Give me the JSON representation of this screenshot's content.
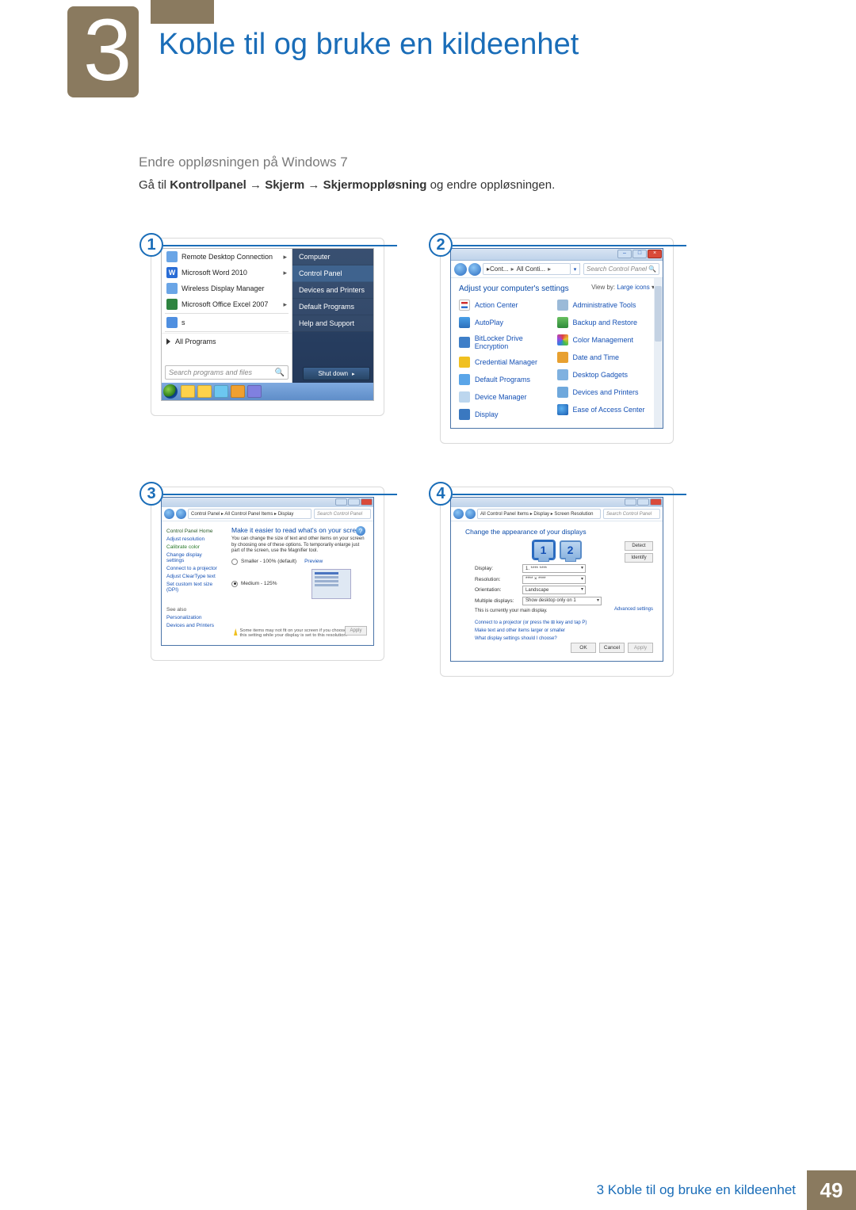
{
  "chapter": {
    "number": "3",
    "title": "Koble til og bruke en kildeenhet"
  },
  "section_subtitle": "Endre oppløsningen på Windows 7",
  "instruction": {
    "prefix": "Gå til ",
    "b1": "Kontrollpanel",
    "arrow": " → ",
    "b2": "Skjerm",
    "b3": "Skjermoppløsning",
    "suffix": " og endre oppløsningen."
  },
  "step_labels": {
    "s1": "1",
    "s2": "2",
    "s3": "3",
    "s4": "4"
  },
  "step1": {
    "left_items": [
      "Remote Desktop Connection",
      "Microsoft Word 2010",
      "Wireless Display Manager",
      "Microsoft Office Excel 2007"
    ],
    "blank_label": "s",
    "all_programs": "All Programs",
    "search_placeholder": "Search programs and files",
    "right_links": [
      "Computer",
      "Control Panel",
      "Devices and Printers",
      "Default Programs",
      "Help and Support"
    ],
    "shutdown": "Shut down"
  },
  "step2": {
    "crumb_parts": [
      "Cont...",
      "All Conti..."
    ],
    "search_placeholder": "Search Control Panel",
    "heading": "Adjust your computer's settings",
    "viewby_label": "View by:",
    "viewby_value": "Large icons",
    "left_col": [
      "Action Center",
      "AutoPlay",
      "BitLocker Drive Encryption",
      "Credential Manager",
      "Default Programs",
      "Device Manager",
      "Display"
    ],
    "right_col": [
      "Administrative Tools",
      "Backup and Restore",
      "Color Management",
      "Date and Time",
      "Desktop Gadgets",
      "Devices and Printers",
      "Ease of Access Center"
    ]
  },
  "step3": {
    "crumb": "Control Panel  ▸  All Control Panel Items  ▸  Display",
    "search_placeholder": "Search Control Panel",
    "side": {
      "home": "Control Panel Home",
      "links": [
        "Adjust resolution",
        "Calibrate color",
        "Change display settings",
        "Connect to a projector",
        "Adjust ClearType text",
        "Set custom text size (DPI)"
      ],
      "see_also": "See also",
      "see_links": [
        "Personalization",
        "Devices and Printers"
      ]
    },
    "heading": "Make it easier to read what's on your screen",
    "paragraph": "You can change the size of text and other items on your screen by choosing one of these options. To temporarily enlarge just part of the screen, use the Magnifier tool.",
    "opt1": "Smaller - 100% (default)",
    "opt1_note": "Preview",
    "opt2": "Medium - 125%",
    "warn": "Some items may not fit on your screen if you choose this setting while your display is set to this resolution.",
    "apply": "Apply"
  },
  "step4": {
    "crumb": "All Control Panel Items  ▸  Display  ▸  Screen Resolution",
    "search_placeholder": "Search Control Panel",
    "heading": "Change the appearance of your displays",
    "mon1": "1",
    "mon2": "2",
    "detect": "Detect",
    "identify": "Identify",
    "rows": {
      "display_lbl": "Display:",
      "display_val": "1. **** ****",
      "res_lbl": "Resolution:",
      "res_val": "**** × ****",
      "orient_lbl": "Orientation:",
      "orient_val": "Landscape",
      "multi_lbl": "Multiple displays:",
      "multi_val": "Show desktop only on 1"
    },
    "main_txt": "This is currently your main display.",
    "adv": "Advanced settings",
    "proj": "Connect to a projector (or press the ⊞ key and tap P)",
    "larger": "Make text and other items larger or smaller",
    "what": "What display settings should I choose?",
    "ok": "OK",
    "cancel": "Cancel",
    "apply": "Apply"
  },
  "footer": {
    "label": "3 Koble til og bruke en kildeenhet",
    "page": "49"
  }
}
